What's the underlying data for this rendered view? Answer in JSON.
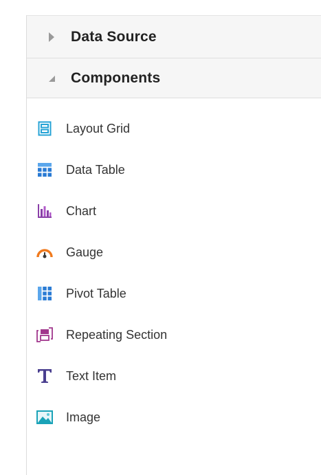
{
  "sections": {
    "data_source": {
      "title": "Data Source",
      "expanded": false
    },
    "components": {
      "title": "Components",
      "expanded": true
    }
  },
  "components": {
    "items": [
      {
        "label": "Layout Grid",
        "icon": "layout-grid-icon",
        "color": "#26a3d6"
      },
      {
        "label": "Data Table",
        "icon": "data-table-icon",
        "color": "#2a7bd4"
      },
      {
        "label": "Chart",
        "icon": "chart-icon",
        "color": "#8a3fa8"
      },
      {
        "label": "Gauge",
        "icon": "gauge-icon",
        "color": "#f07a1e"
      },
      {
        "label": "Pivot Table",
        "icon": "pivot-table-icon",
        "color": "#2a7bd4"
      },
      {
        "label": "Repeating Section",
        "icon": "repeating-section-icon",
        "color": "#a0368c"
      },
      {
        "label": "Text Item",
        "icon": "text-item-icon",
        "color": "#4a3f8f"
      },
      {
        "label": "Image",
        "icon": "image-icon",
        "color": "#1aa3b8"
      }
    ]
  }
}
